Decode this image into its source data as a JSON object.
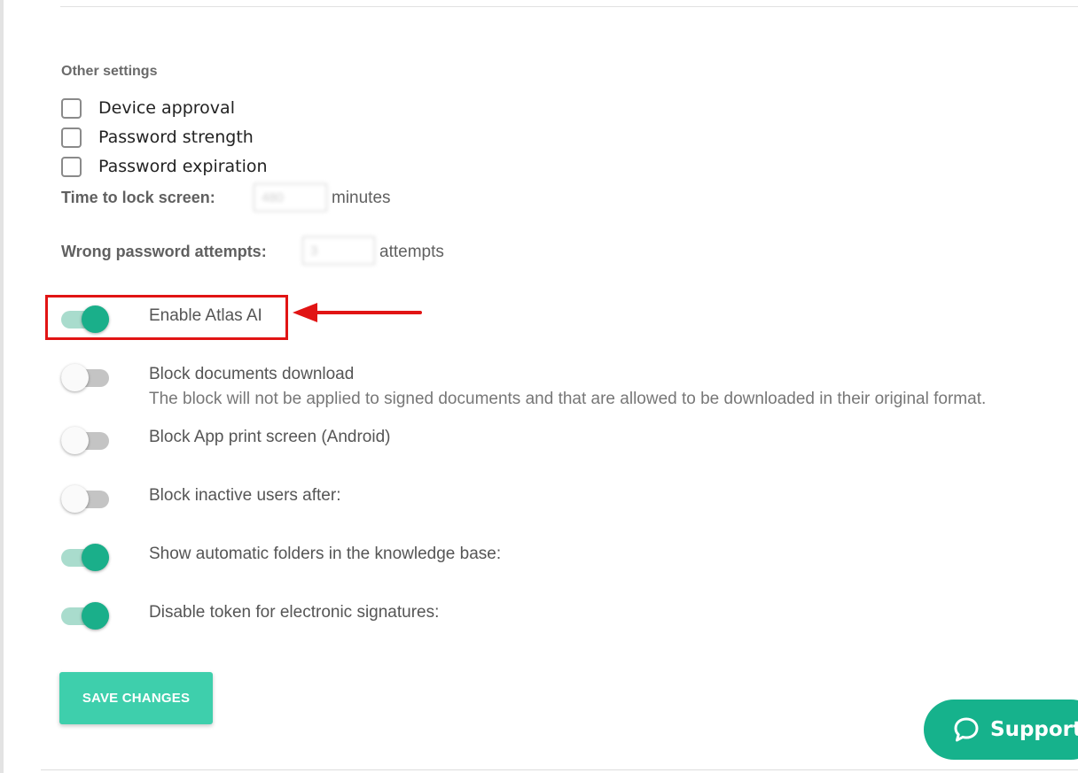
{
  "section": {
    "title": "Other settings"
  },
  "checkboxes": [
    {
      "label": "Device approval",
      "checked": false
    },
    {
      "label": "Password strength",
      "checked": false
    },
    {
      "label": "Password expiration",
      "checked": false
    }
  ],
  "lock_screen": {
    "label": "Time to lock screen:",
    "unit": "minutes",
    "value": "480"
  },
  "password_attempts": {
    "label": "Wrong password attempts:",
    "unit": "attempts",
    "value": "3"
  },
  "toggles": [
    {
      "label": "Enable Atlas AI",
      "on": true
    },
    {
      "label": "Block documents download",
      "description": "The block will not be applied to signed documents and that are allowed to be downloaded in their original format.",
      "on": false
    },
    {
      "label": "Block App print screen (Android)",
      "on": false
    },
    {
      "label": "Block inactive users after:",
      "on": false
    },
    {
      "label": "Show automatic folders in the knowledge base:",
      "on": true
    },
    {
      "label": "Disable token for electronic signatures:",
      "on": true
    }
  ],
  "save_button": {
    "label": "SAVE CHANGES"
  },
  "support": {
    "label": "Support"
  },
  "colors": {
    "accent": "#1aaf8a",
    "button": "#3ecfac",
    "highlight": "#e11414"
  }
}
